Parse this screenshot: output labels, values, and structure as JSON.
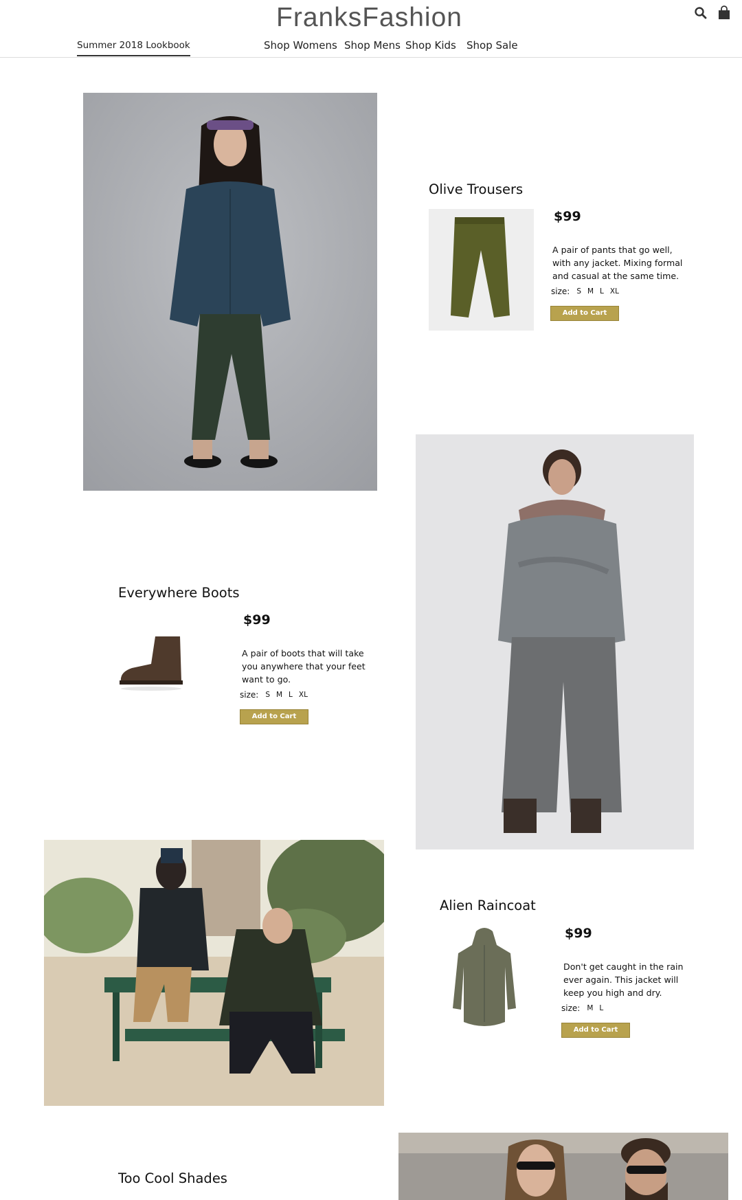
{
  "header": {
    "brand": "FranksFashion",
    "lookbook_label": "Summer 2018 Lookbook",
    "nav": [
      "Shop Womens",
      "Shop Mens",
      "Shop Kids",
      "Shop Sale"
    ],
    "icons": [
      "search-icon",
      "shopping-bag-icon"
    ]
  },
  "products": [
    {
      "title": "Olive Trousers",
      "price": "$99",
      "description": "A pair of pants that go well, with any jacket. Mixing formal and casual at the same time.",
      "size_label": "size:",
      "sizes": [
        "S",
        "M",
        "L",
        "XL"
      ],
      "button": "Add to Cart"
    },
    {
      "title": "Everywhere Boots",
      "price": "$99",
      "description": "A pair of boots that will take you anywhere that your feet want to go.",
      "size_label": "size:",
      "sizes": [
        "S",
        "M",
        "L",
        "XL"
      ],
      "button": "Add to Cart"
    },
    {
      "title": "Alien Raincoat",
      "price": "$99",
      "description": "Don't get caught in the rain ever again. This jacket will keep you high and dry.",
      "size_label": "size:",
      "sizes": [
        "M",
        "L"
      ],
      "button": "Add to Cart"
    },
    {
      "title": "Too Cool Shades"
    }
  ],
  "colors": {
    "button_bg": "#b8a24e",
    "brand_text": "#555555",
    "header_border": "#dcdcdc"
  }
}
